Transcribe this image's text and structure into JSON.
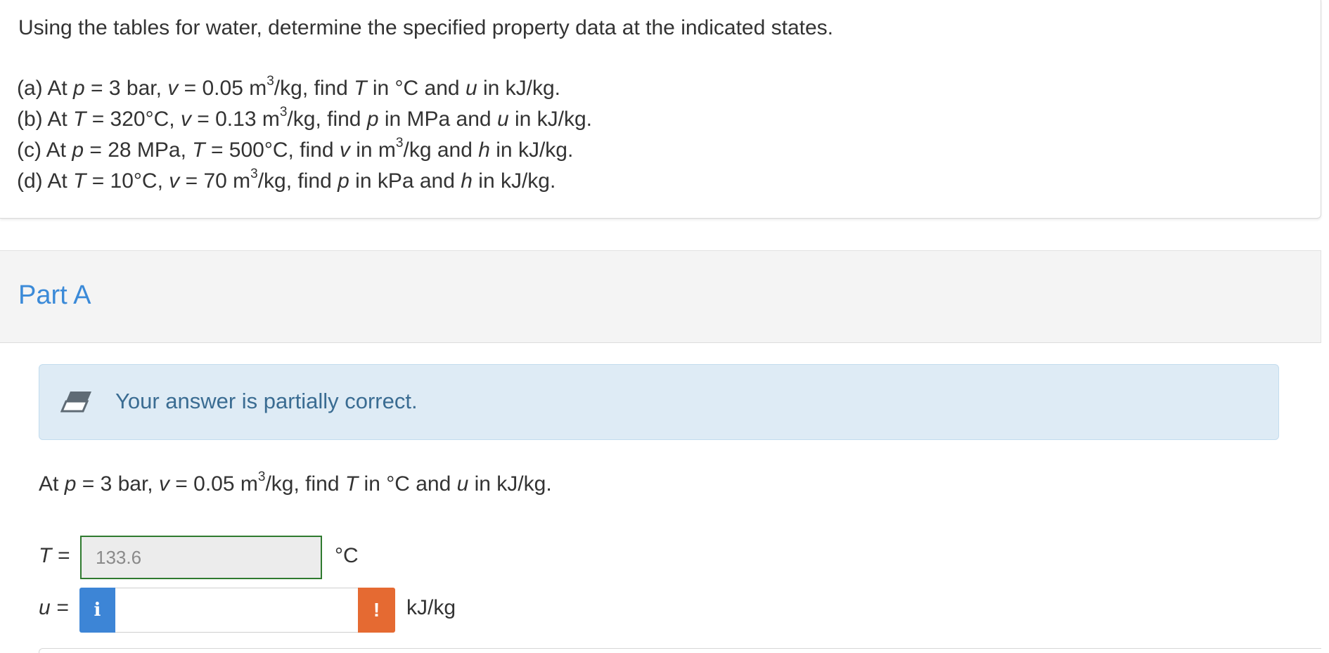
{
  "question": {
    "intro": "Using the tables for water, determine the specified property data at the indicated states.",
    "items": {
      "a": {
        "pre": "(a) At ",
        "p": "p",
        "mid1": " = 3 bar, ",
        "v": "v",
        "mid2": " = 0.05 m",
        "sup": "3",
        "mid3": "/kg, find ",
        "T": "T",
        "mid4": " in °C and ",
        "u": "u",
        "post": " in kJ/kg."
      },
      "b": {
        "pre": "(b) At ",
        "T": "T",
        "mid1": " = 320°C, ",
        "v": "v",
        "mid2": " = 0.13 m",
        "sup": "3",
        "mid3": "/kg, find ",
        "p": "p",
        "mid4": " in MPa and ",
        "u": "u",
        "post": " in kJ/kg."
      },
      "c": {
        "pre": "(c) At ",
        "p": "p",
        "mid1": " = 28 MPa, ",
        "T": "T",
        "mid2": " = 500°C, find ",
        "v": "v",
        "mid3": " in m",
        "sup": "3",
        "mid4": "/kg and ",
        "h": "h",
        "post": " in kJ/kg."
      },
      "d": {
        "pre": "(d) At ",
        "T": "T",
        "mid1": " = 10°C, ",
        "v": "v",
        "mid2": " = 70 m",
        "sup": "3",
        "mid3": "/kg, find ",
        "p": "p",
        "mid4": " in kPa and ",
        "h": "h",
        "post": " in kJ/kg."
      }
    }
  },
  "part": {
    "title": "Part A",
    "feedback": "Your answer is partially correct.",
    "prompt": {
      "pre": "At ",
      "p": "p",
      "mid1": " = 3 bar, ",
      "v": "v",
      "mid2": " = 0.05 m",
      "sup": "3",
      "mid3": "/kg, find ",
      "T": "T",
      "mid4": " in °C and ",
      "u": "u",
      "post": " in kJ/kg."
    }
  },
  "answers": {
    "T": {
      "label": "T =",
      "value": "133.6",
      "unit": "°C",
      "status": "correct"
    },
    "u": {
      "label": "u =",
      "value": "",
      "unit": "kJ/kg",
      "status": "incorrect",
      "info_glyph": "i",
      "warn_glyph": "!"
    }
  },
  "colors": {
    "part_title": "#3b8ad8",
    "feedback_bg": "#deebf5",
    "feedback_text": "#3a6c92",
    "correct_border": "#2f7a2f",
    "info_button": "#3d85d6",
    "warn_button": "#e56a32"
  },
  "icons": {
    "feedback": "eraser-icon",
    "info": "info-icon",
    "warning": "exclamation-icon"
  }
}
